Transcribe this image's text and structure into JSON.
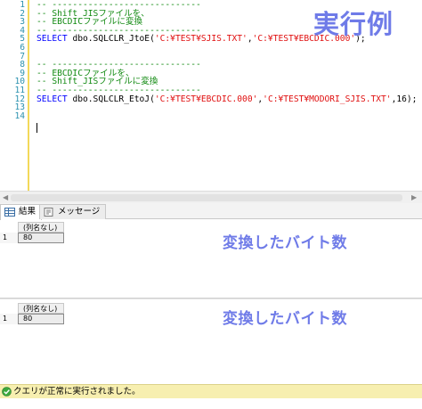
{
  "editor": {
    "overlay_title": "実行例",
    "lines": [
      {
        "n": "1",
        "segments": [
          {
            "t": "-- -----------------------------",
            "c": "comment"
          }
        ]
      },
      {
        "n": "2",
        "segments": [
          {
            "t": "-- Shift_JISファイルを、",
            "c": "comment"
          }
        ]
      },
      {
        "n": "3",
        "segments": [
          {
            "t": "-- EBCDICファイルに変換",
            "c": "comment"
          }
        ]
      },
      {
        "n": "4",
        "segments": [
          {
            "t": "-- -----------------------------",
            "c": "comment"
          }
        ]
      },
      {
        "n": "5",
        "segments": [
          {
            "t": "SELECT ",
            "c": "kw"
          },
          {
            "t": "dbo.SQLCLR_JtoE(",
            "c": "fn"
          },
          {
            "t": "'C:¥TEST¥SJIS.TXT'",
            "c": "str"
          },
          {
            "t": ",",
            "c": "fn"
          },
          {
            "t": "'C:¥TEST¥EBCDIC.000'",
            "c": "str"
          },
          {
            "t": ");",
            "c": "fn"
          }
        ]
      },
      {
        "n": "6",
        "segments": []
      },
      {
        "n": "7",
        "segments": []
      },
      {
        "n": "8",
        "segments": [
          {
            "t": "-- -----------------------------",
            "c": "comment"
          }
        ]
      },
      {
        "n": "9",
        "segments": [
          {
            "t": "-- EBCDICファイルを、",
            "c": "comment"
          }
        ]
      },
      {
        "n": "10",
        "segments": [
          {
            "t": "-- Shift_JISファイルに変換",
            "c": "comment"
          }
        ]
      },
      {
        "n": "11",
        "segments": [
          {
            "t": "-- -----------------------------",
            "c": "comment"
          }
        ]
      },
      {
        "n": "12",
        "segments": [
          {
            "t": "SELECT ",
            "c": "kw"
          },
          {
            "t": "dbo.SQLCLR_EtoJ(",
            "c": "fn"
          },
          {
            "t": "'C:¥TEST¥EBCDIC.000'",
            "c": "str"
          },
          {
            "t": ",",
            "c": "fn"
          },
          {
            "t": "'C:¥TEST¥MODORI_SJIS.TXT'",
            "c": "str"
          },
          {
            "t": ",16);",
            "c": "fn"
          }
        ]
      },
      {
        "n": "13",
        "segments": []
      },
      {
        "n": "14",
        "segments": []
      }
    ]
  },
  "tabs": [
    {
      "label": "結果",
      "icon": "grid-icon",
      "active": true
    },
    {
      "label": "メッセージ",
      "icon": "message-icon",
      "active": false
    }
  ],
  "results": [
    {
      "column_header": "(列名なし)",
      "row_number": "1",
      "value": "80",
      "annotation": "変換したバイト数"
    },
    {
      "column_header": "(列名なし)",
      "row_number": "1",
      "value": "80",
      "annotation": "変換したバイト数"
    }
  ],
  "status": {
    "icon": "check-circle-icon",
    "text": "クエリが正常に実行されました。"
  },
  "colors": {
    "accent_overlay": "#6f7be8",
    "status_bar": "#f7efb0",
    "comment": "#128a12",
    "keyword": "#0000ff",
    "string": "#e01010"
  }
}
